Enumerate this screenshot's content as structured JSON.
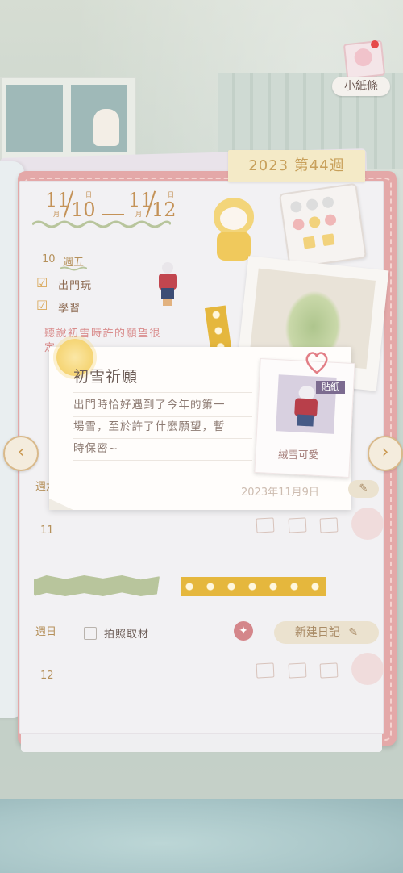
{
  "header": {
    "note_label": "小紙條",
    "week_title": "2023 第44週"
  },
  "date_range": {
    "start_month": "11",
    "start_day": "10",
    "end_month": "11",
    "end_day": "12",
    "month_suffix": "月",
    "day_suffix": "日"
  },
  "days": [
    {
      "date": "10",
      "weekday": "週五",
      "tasks": [
        {
          "label": "出門玩",
          "checked": true
        },
        {
          "label": "學習",
          "checked": true
        }
      ],
      "note": "聽說初雪時許的願望很",
      "note_line2": "定"
    },
    {
      "weekday": "週六",
      "date": "11"
    },
    {
      "weekday": "週日",
      "date": "12",
      "tasks": [
        {
          "label": "拍照取材",
          "checked": false
        }
      ],
      "new_entry_label": "新建日記"
    }
  ],
  "popup": {
    "title": "初雪祈願",
    "body_line1": "出門時恰好遇到了今年的第一",
    "body_line2": "場雪，至於許了什麼願望，暫",
    "body_line3": "時保密~",
    "date": "2023年11月9日",
    "sticker_tag": "貼紙",
    "sticker_caption": "絨雪可愛"
  },
  "nav": {
    "prev_icon": "‹",
    "next_icon": "›"
  },
  "colors": {
    "cover": "#e4a8a8",
    "accent_gold": "#c49257",
    "note_pink": "#d98c8c"
  }
}
